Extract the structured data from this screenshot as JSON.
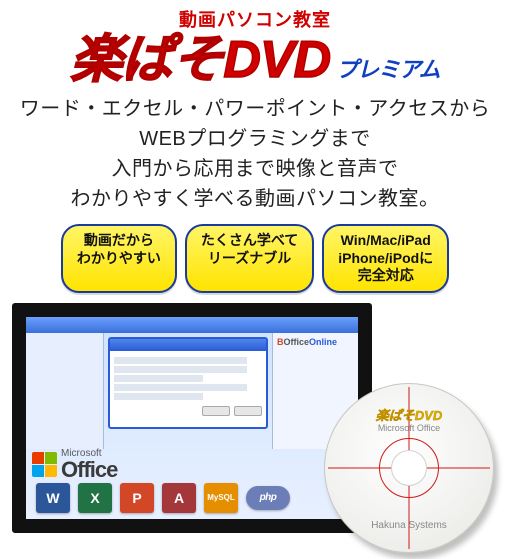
{
  "tagline": "動画パソコン教室",
  "title_main": "楽ぱそDVD",
  "title_sub": "プレミアム",
  "description_lines": [
    "ワード・エクセル・パワーポイント・アクセスから",
    "WEBプログラミングまで",
    "入門から応用まで映像と音声で",
    "わかりやすく学べる動画パソコン教室。"
  ],
  "badges": [
    "動画だから\nわかりやすい",
    "たくさん学べて\nリーズナブル",
    "Win/Mac/iPad\niPhone/iPodに\n完全対応"
  ],
  "player": {
    "sidebar_right_brand_1": "B",
    "sidebar_right_brand_2": "Office",
    "sidebar_right_suffix": "Online",
    "office_small": "Microsoft",
    "office_big": "Office"
  },
  "app_icons": {
    "word": "W",
    "excel": "X",
    "powerpoint": "P",
    "access": "A",
    "mysql": "MySQL",
    "php": "php"
  },
  "disc": {
    "title": "楽ぱそDVD",
    "subtitle": "Microsoft Office",
    "maker": "Hakuna Systems"
  }
}
